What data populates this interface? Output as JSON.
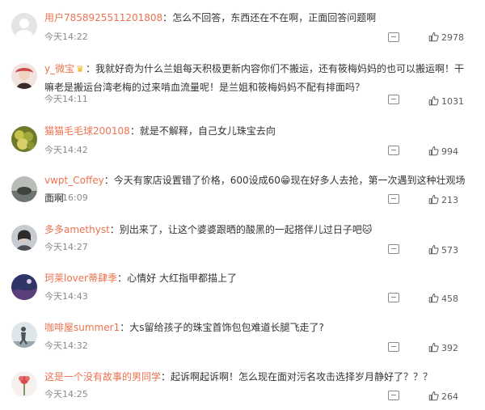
{
  "comments": [
    {
      "user": "用户7858925511201808",
      "separator": "：",
      "text": "怎么不回答，东西还在不在啊，正面回答问题啊",
      "time": "今天14:22",
      "likes": "2978",
      "avatar_color": "#e4e4e4",
      "avatar_icon": "default-user-icon"
    },
    {
      "user": "y_微宝",
      "separator": "：",
      "text": "我就好奇为什么兰姐每天积极更新内容你们不搬运，还有筱梅妈妈的也可以搬运啊！干嘛老是搬运台湾老梅的过来啃血流量呢！是兰姐和筱梅妈妈不配有排面吗？",
      "time": "今天14:11",
      "likes": "1031",
      "avatar_color": "#c94a4a",
      "avatar_icon": "user-photo-icon",
      "badge_icon": "crown-icon"
    },
    {
      "user": "猫猫毛毛球200108",
      "separator": "：",
      "text": "就是不解释，自己女儿珠宝去向",
      "time": "今天14:42",
      "likes": "994",
      "avatar_color": "#a0a83a",
      "avatar_icon": "user-photo-icon"
    },
    {
      "user": "vwpt_Coffey",
      "separator": "：",
      "text_before": "今天有家店设置错了价格，600设成60",
      "text_after": "现在好多人去抢，第一次遇到这种壮观场面啊",
      "emoji": "😁",
      "time": "今天16:09",
      "likes": "213",
      "avatar_color": "#8a8f8c",
      "avatar_icon": "user-photo-icon"
    },
    {
      "user": "多多amethyst",
      "separator": "：",
      "text": "别出来了，让这个婆婆跟晒的酸黑的一起搭伴儿过日子吧",
      "emoji": "🐱",
      "time": "今天14:27",
      "likes": "573",
      "avatar_color": "#9aa0a6",
      "avatar_icon": "user-photo-icon"
    },
    {
      "user": "珂莱lover蒂肆季",
      "separator": "：",
      "text": "心情好 大红指甲都描上了",
      "time": "今天14:43",
      "likes": "458",
      "avatar_color": "#3b3f6e",
      "avatar_icon": "user-photo-icon"
    },
    {
      "user": "咖啡屋summer1",
      "separator": "：",
      "text": "大s留给孩子的珠宝首饰包包难道长腿飞走了?",
      "time": "今天14:32",
      "likes": "392",
      "avatar_color": "#7d8e98",
      "avatar_icon": "user-photo-icon"
    },
    {
      "user": "这是一个没有故事的男同学",
      "separator": "：",
      "text": "起诉啊起诉啊！怎么现在面对污名攻击选择岁月静好了？？？",
      "time": "今天14:25",
      "likes": "264",
      "avatar_color": "#e9a0a0",
      "avatar_icon": "user-photo-icon"
    }
  ]
}
